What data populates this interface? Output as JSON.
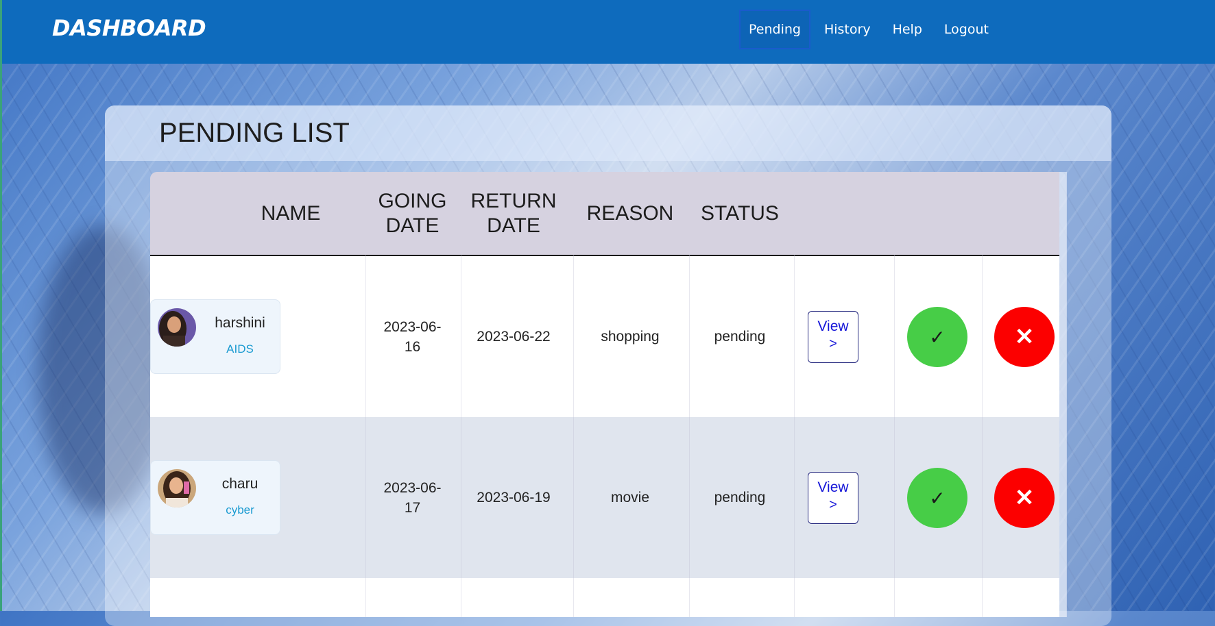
{
  "navbar": {
    "brand": "DASHBOARD",
    "items": [
      {
        "label": "Pending",
        "active": true
      },
      {
        "label": "History"
      },
      {
        "label": "Help"
      },
      {
        "label": "Logout"
      }
    ]
  },
  "panel": {
    "title": "PENDING LIST"
  },
  "table": {
    "headers": [
      "NAME",
      "GOING DATE",
      "RETURN DATE",
      "REASON",
      "STATUS"
    ],
    "rows": [
      {
        "name": "harshini",
        "dept": "AIDS",
        "going_date": "2023-06-16",
        "return_date": "2023-06-22",
        "reason": "shopping",
        "status": "pending",
        "view_label": "View",
        "view_icon": "chevron-right-icon"
      },
      {
        "name": "charu",
        "dept": "cyber",
        "going_date": "2023-06-17",
        "return_date": "2023-06-19",
        "reason": "movie",
        "status": "pending",
        "view_label": "View",
        "view_icon": "chevron-right-icon"
      }
    ]
  },
  "colors": {
    "navbar": "#0e6bbd",
    "approve": "#47cd47",
    "reject": "#fc0000",
    "dept_text": "#1b9bd1",
    "view_text": "#1515d8"
  },
  "icons": {
    "approve": "checkmark-icon",
    "reject": "close-icon",
    "view": "chevron-right-icon"
  }
}
